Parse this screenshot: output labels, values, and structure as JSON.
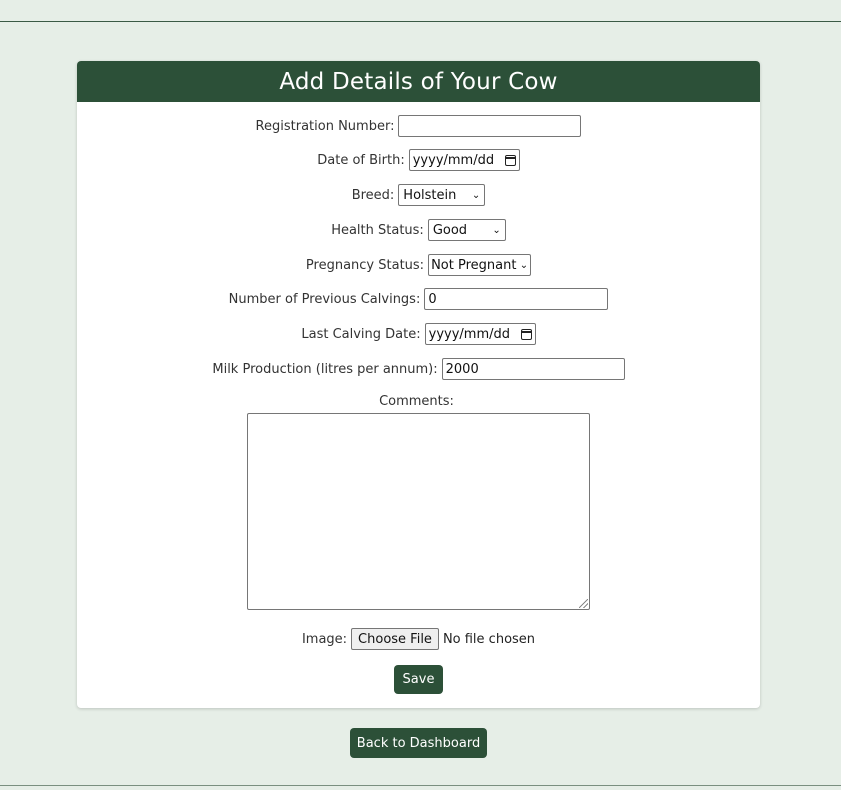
{
  "form": {
    "title": "Add Details of Your Cow",
    "registration": {
      "label": "Registration Number:",
      "value": ""
    },
    "dob": {
      "label": "Date of Birth:",
      "value": "yyyy/mm/dd"
    },
    "breed": {
      "label": "Breed:",
      "selected": "Holstein"
    },
    "health": {
      "label": "Health Status:",
      "selected": "Good"
    },
    "pregnancy": {
      "label": "Pregnancy Status:",
      "selected": "Not Pregnant"
    },
    "calvings": {
      "label": "Number of Previous Calvings:",
      "value": "0"
    },
    "last_calving": {
      "label": "Last Calving Date:",
      "value": "yyyy/mm/dd"
    },
    "milk": {
      "label": "Milk Production (litres per annum):",
      "value": "2000"
    },
    "comments": {
      "label": "Comments:",
      "value": ""
    },
    "image": {
      "label": "Image:",
      "button": "Choose File",
      "status": "No file chosen"
    },
    "save_label": "Save"
  },
  "back_label": "Back to Dashboard",
  "colors": {
    "accent": "#2c5038",
    "background": "#e6eee7"
  }
}
